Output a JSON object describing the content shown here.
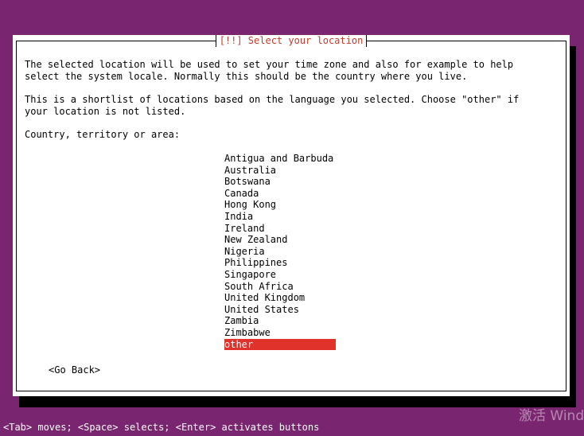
{
  "dialog": {
    "title": "[!!] Select your location",
    "intro_line1": "The selected location will be used to set your time zone and also for example to help",
    "intro_line2": "select the system locale. Normally this should be the country where you live.",
    "shortlist_line1": "This is a shortlist of locations based on the language you selected. Choose \"other\" if",
    "shortlist_line2": "your location is not listed.",
    "prompt": "Country, territory or area:",
    "countries": [
      "Antigua and Barbuda",
      "Australia",
      "Botswana",
      "Canada",
      "Hong Kong",
      "India",
      "Ireland",
      "New Zealand",
      "Nigeria",
      "Philippines",
      "Singapore",
      "South Africa",
      "United Kingdom",
      "United States",
      "Zambia",
      "Zimbabwe",
      "other"
    ],
    "selected_country": "other",
    "go_back_label": "<Go Back>"
  },
  "status_bar": {
    "help_text": "<Tab> moves; <Space> selects; <Enter> activates buttons"
  },
  "watermark": {
    "text": "激活 Wind"
  },
  "colors": {
    "background": "#79256f",
    "selection": "#e0312b",
    "title_text": "#c53b2c"
  }
}
